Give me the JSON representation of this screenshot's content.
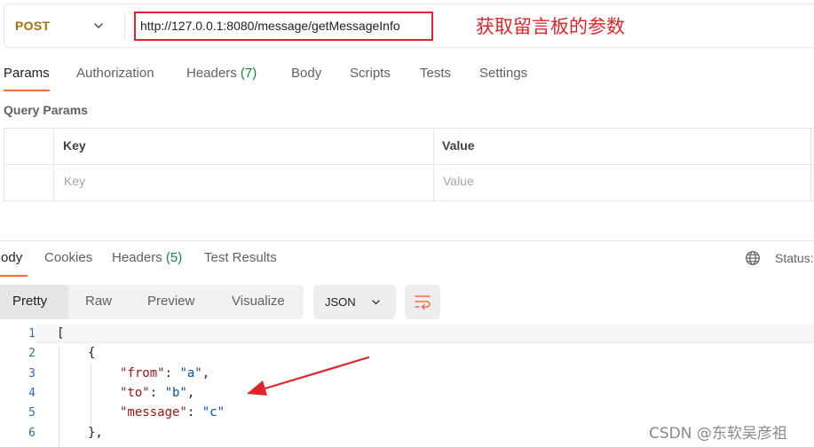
{
  "request": {
    "method": "POST",
    "url": "http://127.0.0.1:8080/message/getMessageInfo",
    "annotation": "获取留言板的参数"
  },
  "request_tabs": {
    "params": "Params",
    "authorization": "Authorization",
    "headers": "Headers",
    "headers_count": "(7)",
    "body": "Body",
    "scripts": "Scripts",
    "tests": "Tests",
    "settings": "Settings"
  },
  "query_params": {
    "title": "Query Params",
    "header_key": "Key",
    "header_value": "Value",
    "placeholder_key": "Key",
    "placeholder_value": "Value"
  },
  "response_tabs": {
    "body": "Body",
    "cookies": "Cookies",
    "headers": "Headers",
    "headers_count": "(5)",
    "test_results": "Test Results",
    "status_label": "Status:"
  },
  "view_modes": {
    "pretty": "Pretty",
    "raw": "Raw",
    "preview": "Preview",
    "visualize": "Visualize",
    "format": "JSON"
  },
  "code": {
    "line_numbers": [
      "1",
      "2",
      "3",
      "4",
      "5",
      "6"
    ],
    "open_bracket": "[",
    "open_brace": "{",
    "from_key": "\"from\"",
    "from_value": "\"a\"",
    "to_key": "\"to\"",
    "to_value": "\"b\"",
    "message_key": "\"message\"",
    "message_value": "\"c\"",
    "close_brace": "},"
  },
  "watermark": "CSDN @东软吴彦祖",
  "colors": {
    "accent": "#ff6c37",
    "method": "#a86f0d",
    "annotation": "#e0242a",
    "count": "#0f8542"
  }
}
